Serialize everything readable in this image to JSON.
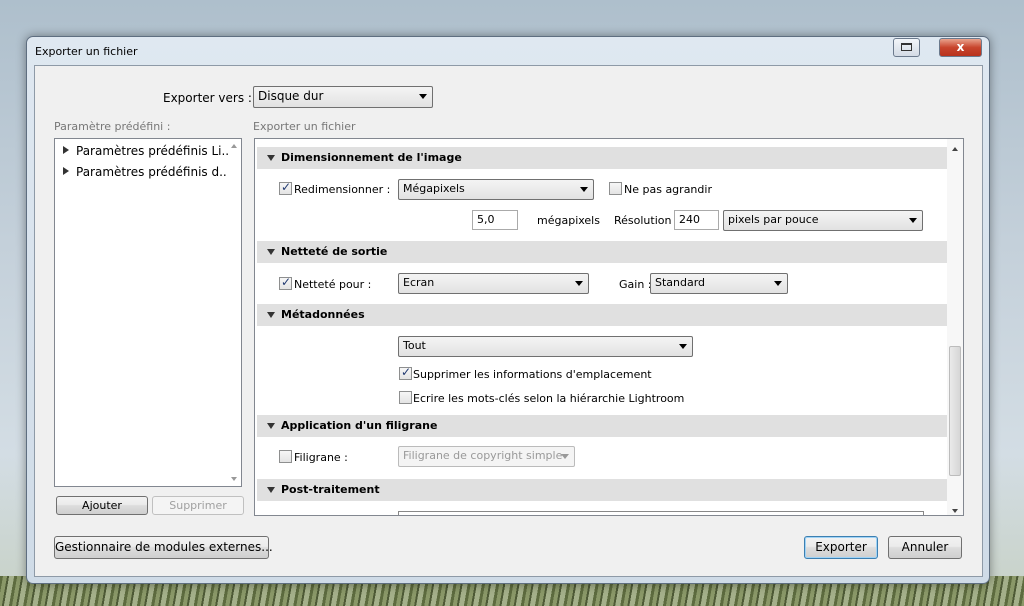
{
  "window": {
    "title": "Exporter un fichier",
    "close_label": "x"
  },
  "export_to": {
    "label": "Exporter vers :",
    "value": "Disque dur"
  },
  "presets": {
    "heading": "Paramètre prédéfini :",
    "items": [
      "Paramètres prédéfinis Li...",
      "Paramètres prédéfinis d..."
    ],
    "add_label": "Ajouter",
    "remove_label": "Supprimer"
  },
  "export_heading": "Exporter un fichier",
  "sections": {
    "sizing": {
      "title": "Dimensionnement de l'image",
      "resize_label": "Redimensionner :",
      "resize_checked": true,
      "mode": "Mégapixels",
      "no_enlarge_label": "Ne pas agrandir",
      "no_enlarge_checked": false,
      "mp_value": "5,0",
      "mp_unit": "mégapixels",
      "resolution_label": "Résolution :",
      "resolution_value": "240",
      "resolution_unit": "pixels par pouce"
    },
    "sharpen": {
      "title": "Netteté de sortie",
      "sharpen_label": "Netteté pour :",
      "sharpen_checked": true,
      "target": "Ecran",
      "gain_label": "Gain :",
      "gain_value": "Standard"
    },
    "metadata": {
      "title": "Métadonnées",
      "include": "Tout",
      "remove_location_label": "Supprimer les informations d'emplacement",
      "remove_location_checked": true,
      "hierarchy_label": "Ecrire les mots-clés selon la hiérarchie Lightroom",
      "hierarchy_checked": false
    },
    "watermark": {
      "title": "Application d'un filigrane",
      "label": "Filigrane :",
      "checked": false,
      "value": "Filigrane de copyright simple"
    },
    "post": {
      "title": "Post-traitement"
    }
  },
  "footer": {
    "plugin_manager_label": "Gestionnaire de modules externes...",
    "export_label": "Exporter",
    "cancel_label": "Annuler"
  }
}
